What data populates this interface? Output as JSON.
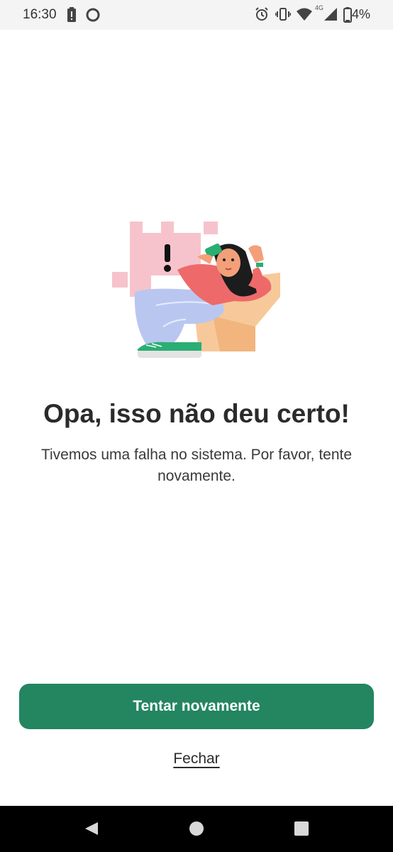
{
  "status_bar": {
    "time": "16:30",
    "battery_text": "4%",
    "network_label": "4G",
    "icons": [
      "battery-alert-icon",
      "circle-notification-icon",
      "alarm-icon",
      "vibrate-icon",
      "wifi-icon",
      "signal-icon",
      "battery-icon"
    ]
  },
  "error": {
    "illustration": "woman-with-phone-error-illustration",
    "title": "Opa, isso não deu certo!",
    "message": "Tivemos uma falha no sistema. Por favor, tente novamente."
  },
  "actions": {
    "retry_label": "Tentar novamente",
    "close_label": "Fechar"
  },
  "nav_bar": {
    "icons": [
      "back-icon",
      "home-icon",
      "recents-icon"
    ]
  },
  "colors": {
    "primary": "#238661",
    "status_bar_bg": "#f4f4f4",
    "nav_bar_bg": "#000000"
  }
}
